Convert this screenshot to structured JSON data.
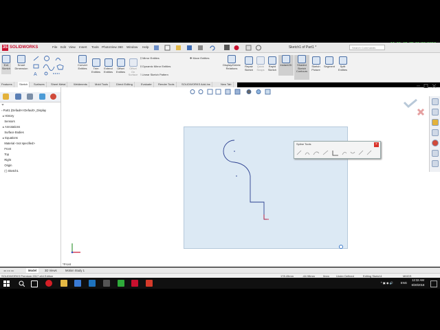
{
  "app": {
    "brand": "SOLIDWORKS",
    "window_title": "Sketch1 of Part1 *",
    "search_placeholder": "Search Commands"
  },
  "clock_overlay": "12:32:47 AM 06/30/2018",
  "menus": [
    "File",
    "Edit",
    "View",
    "Insert",
    "Tools",
    "PhotoView 360",
    "Window",
    "Help"
  ],
  "ribbon": {
    "exit_sketch": "Exit Sketch",
    "smart_dimension": "Smart Dimension",
    "convert_entities": "Convert Entities",
    "trim_entities": "Trim Entities",
    "extend_entities": "Extend Entities",
    "offset_entities": "Offset Entities",
    "offset_on_surface": "Offset On Surface",
    "mirror_entities": "Mirror Entities",
    "dynamic_mirror": "Dynamic Mirror Entities",
    "linear_pattern": "Linear Sketch Pattern",
    "move_entities": "Move Entities",
    "display_delete": "Display/Delete Relations",
    "repair_sketch": "Repair Sketch",
    "quick_snaps": "Quick Snaps",
    "rapid_sketch": "Rapid Sketch",
    "instant2d": "Instant2D",
    "shaded_contours": "Shaded Sketch Contours",
    "sketch_picture": "Sketch Picture",
    "segment": "Segment",
    "split_entities": "Split Entities"
  },
  "tabs": [
    "Features",
    "Sketch",
    "Surfaces",
    "Sheet Metal",
    "Weldments",
    "Mold Tools",
    "Direct Editing",
    "Evaluate",
    "Render Tools",
    "SOLIDWORKS Add-Ins",
    "New Tab"
  ],
  "active_tab": "Sketch",
  "feature_tree": {
    "root": "Part1  (Default<<Default>_Display",
    "items": [
      "History",
      "Sensors",
      "Annotations",
      "Surface Bodies",
      "Equations",
      "Material <not specified>",
      "Front",
      "Top",
      "Right",
      "Origin",
      "(-) Sketch1"
    ]
  },
  "spline_tools": {
    "title": "Spline Tools",
    "close": "×"
  },
  "view_label": "*Front",
  "bottom_tabs": [
    "Model",
    "3D Views",
    "Motion Study 1"
  ],
  "active_bottom_tab": "Model",
  "status": {
    "edition": "SOLIDWORKS Premium 2017 x64 Edition",
    "x": "178.49mm",
    "y": "-64.98mm",
    "z": "0mm",
    "state": "Under Defined",
    "editing": "Editing Sketch1",
    "units": "MMGS"
  },
  "taskbar": {
    "lang": "ENG",
    "time": "12:32 AM",
    "date": "6/30/2018"
  },
  "colors": {
    "accent": "#c8102e",
    "sketch_line": "#2a3f8f",
    "sheet": "#dce9f4"
  }
}
